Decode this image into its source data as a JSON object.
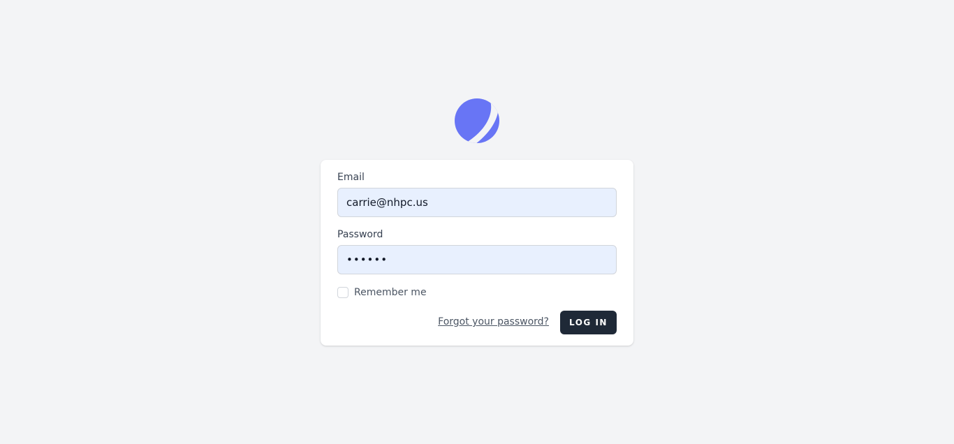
{
  "brand": {
    "logo_icon": "crescent-globe-icon",
    "logo_color": "#6875f5"
  },
  "form": {
    "email_label": "Email",
    "email_value": "carrie@nhpc.us",
    "password_label": "Password",
    "password_value": "••••••",
    "remember_label": "Remember me",
    "remember_checked": false,
    "forgot_link": "Forgot your password?",
    "login_button": "LOG IN"
  },
  "colors": {
    "background": "#f3f4f6",
    "card": "#ffffff",
    "input_fill": "#e8f0fe",
    "button": "#1f2937"
  }
}
